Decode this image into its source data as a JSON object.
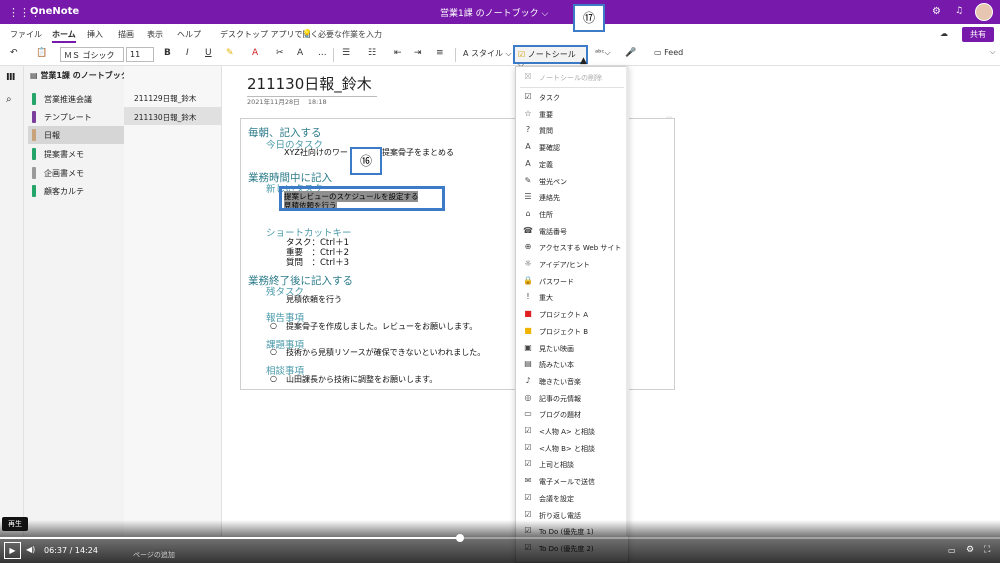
{
  "titlebar": {
    "app_name": "OneNote",
    "notebook_title": "営業1課 のノートブック ⌵",
    "waffle_icon": "⋮⋮⋮",
    "settings_icon": "⚙",
    "bell_icon": "🔔"
  },
  "menu": {
    "items": [
      "ファイル",
      "ホーム",
      "挿入",
      "描画",
      "表示",
      "ヘルプ"
    ],
    "desktop_open": "デスクトップ アプリで開く",
    "tell_me": "必要な作業を入力",
    "share": "共有"
  },
  "ribbon": {
    "font_name": "ＭＳ ゴシック",
    "font_size": "11",
    "bold": "B",
    "italic": "I",
    "underline": "U",
    "styles": "スタイル",
    "note_tags": "ノートシール",
    "feed": "Feed",
    "more": "..."
  },
  "sidebar": {
    "notebook_name": "営業1課 のノートブック",
    "sections": [
      {
        "label": "営業推進会議",
        "color": "#25a56a"
      },
      {
        "label": "テンプレート",
        "color": "#7a3e9d"
      },
      {
        "label": "日報",
        "color": "#c7a27a"
      },
      {
        "label": "提案書メモ",
        "color": "#25a56a"
      },
      {
        "label": "企画書メモ",
        "color": "#9a9a9a"
      },
      {
        "label": "顧客カルテ",
        "color": "#25a56a"
      }
    ],
    "pages": [
      "211129日報_鈴木",
      "211130日報_鈴木"
    ],
    "add_page": "ページの追加"
  },
  "page": {
    "title": "211130日報_鈴木",
    "date": "2021年11月28日",
    "time": "18:18",
    "content": {
      "h_morning": "毎朝、記入する",
      "h_today": "今日のタスク",
      "task_xyz": "XYZ社向けのワー",
      "task_xyz_rest": "提案骨子をまとめる",
      "h_during": "業務時間中に記入",
      "h_new": "新しいタスク",
      "new_1": "提案レビューのスケジュールを設定する",
      "new_2": "見積依頼を行う",
      "h_shortcut": "ショートカットキー",
      "sc_task": "タスク：Ctrl＋1",
      "sc_important": "重要　：Ctrl＋2",
      "sc_question": "質問　：Ctrl＋3",
      "h_after": "業務終了後に記入する",
      "h_remaining": "残タスク",
      "remaining_1": "見積依頼を行う",
      "h_report": "報告事項",
      "report_1": "提案骨子を作成しました。レビューをお願いします。",
      "h_issue": "課題事項",
      "issue_1": "技術から見積リソースが確保できないといわれました。",
      "h_consult": "相談事項",
      "consult_1": "山田課長から技術に調整をお願いします。",
      "bullet": "○"
    }
  },
  "callouts": {
    "c16": "⑯",
    "c17": "⑰"
  },
  "note_tag_menu": {
    "remove": "ノートシールの削除",
    "items": [
      {
        "label": "タスク",
        "icon": "☑"
      },
      {
        "label": "重要",
        "icon": "☆"
      },
      {
        "label": "質問",
        "icon": "?"
      },
      {
        "label": "要確認",
        "icon": "A"
      },
      {
        "label": "定義",
        "icon": "A"
      },
      {
        "label": "蛍光ペン",
        "icon": "✎"
      },
      {
        "label": "連絡先",
        "icon": "☰"
      },
      {
        "label": "住所",
        "icon": "⌂"
      },
      {
        "label": "電話番号",
        "icon": "☎"
      },
      {
        "label": "アクセスする Web サイト",
        "icon": "⊕"
      },
      {
        "label": "アイデア/ヒント",
        "icon": "☼"
      },
      {
        "label": "パスワード",
        "icon": "🔒"
      },
      {
        "label": "重大",
        "icon": "!"
      },
      {
        "label": "プロジェクト A",
        "icon": "■",
        "color": "#e02020"
      },
      {
        "label": "プロジェクト B",
        "icon": "■",
        "color": "#f0b400"
      },
      {
        "label": "見たい映画",
        "icon": "▣"
      },
      {
        "label": "読みたい本",
        "icon": "▤"
      },
      {
        "label": "聴きたい音楽",
        "icon": "♪"
      },
      {
        "label": "記事の元情報",
        "icon": "◎"
      },
      {
        "label": "ブログの題材",
        "icon": "▭"
      },
      {
        "label": "<人物 A> と相談",
        "icon": "☑"
      },
      {
        "label": "<人物 B> と相談",
        "icon": "☑"
      },
      {
        "label": "上司と相談",
        "icon": "☑"
      },
      {
        "label": "電子メールで送信",
        "icon": "✉"
      },
      {
        "label": "会議を設定",
        "icon": "☑"
      },
      {
        "label": "折り返し電話",
        "icon": "☑"
      },
      {
        "label": "To Do (優先度 1)",
        "icon": "☑"
      },
      {
        "label": "To Do (優先度 2)",
        "icon": "☑"
      }
    ]
  },
  "player": {
    "play_tooltip": "再生",
    "current_time": "06:37",
    "separator": "/",
    "total_time": "14:24",
    "progress": 0.46
  }
}
